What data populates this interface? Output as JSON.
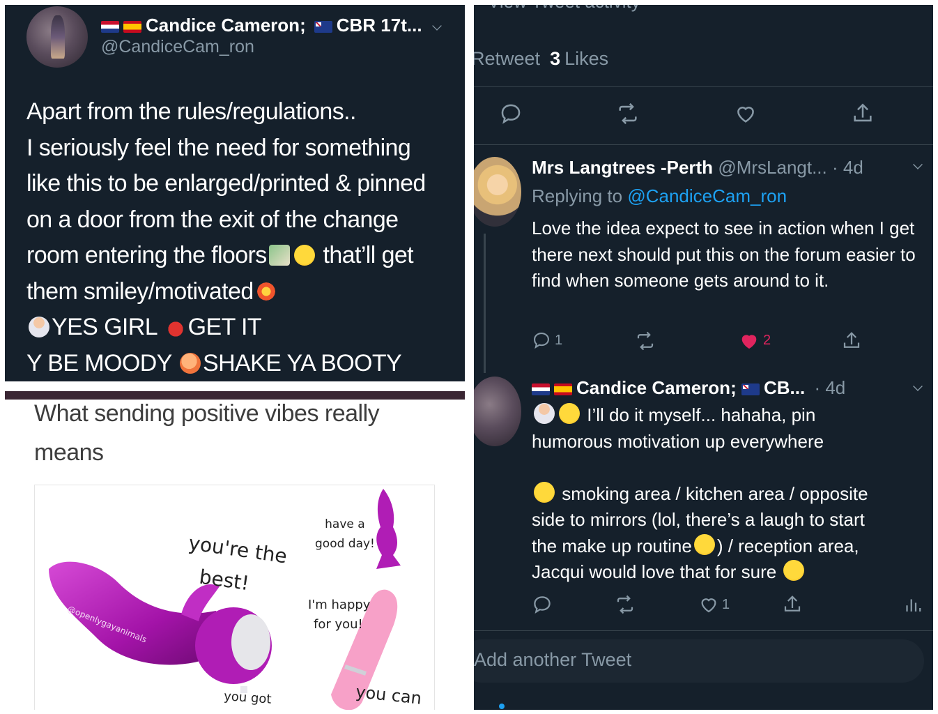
{
  "main_tweet": {
    "display_name": "Candice Cameron;",
    "display_name_suffix": "CBR 17t...",
    "handle": "@CandiceCam_ron",
    "flags": [
      "netherlands-antilles-flag-icon",
      "spain-flag-icon",
      "australia-flag-icon"
    ],
    "body_lines": [
      "Apart from the rules/regulations..",
      "I seriously feel the need for something",
      "like this to be enlarged/printed & pinned",
      "on a door from the exit of the change",
      "room entering the floors",
      "that’ll get",
      "them smiley/motivated",
      "YES GIRL",
      "GET IT",
      "Y BE MOODY",
      "SHAKE YA BOOTY"
    ]
  },
  "meme": {
    "caption": "What sending positive vibes really means",
    "watermark": "@openlygayanimals",
    "label_best_1": "you're the",
    "label_best_2": "best!",
    "label_goodday_1": "have a",
    "label_goodday_2": "good day!",
    "label_happy_1": "I'm happy",
    "label_happy_2": "for you!",
    "label_youcan": "you can",
    "label_yougot": "you got",
    "colors": {
      "toy_purple": "#b31fb3",
      "toy_pink": "#f7a1c8"
    }
  },
  "thread": {
    "activity_label": "View Tweet activity",
    "stats": {
      "retweet_label": "Retweet",
      "likes_count": "3",
      "likes_label": "Likes"
    },
    "actions": [
      "reply-icon",
      "retweet-icon",
      "like-icon",
      "share-icon"
    ],
    "reply1": {
      "display_name": "Mrs Langtrees -Perth",
      "handle_time": "@MrsLangt... · 4d",
      "replying_prefix": "Replying to",
      "replying_mention": "@CandiceCam_ron",
      "body": "Love the idea expect to see in action when I get there next should put this on the forum easier to find when someone gets around to it.",
      "reply_count": "1",
      "like_count": "2"
    },
    "reply2": {
      "display_name": "Candice Cameron;",
      "display_name_suffix": "CB...",
      "time": "· 4d",
      "lines": [
        "I’ll do it myself... hahaha, pin",
        "humorous motivation up everywhere",
        "",
        "smoking area / kitchen area / opposite",
        "side to mirrors (lol, there’s a laugh to start",
        "the make up routine",
        ") / reception area,",
        "Jacqui would love that for sure"
      ],
      "like_count": "1"
    },
    "compose_placeholder": "Add another Tweet",
    "colors": {
      "background": "#15202b",
      "secondary_text": "#8899a6",
      "accent": "#1da1f2",
      "like_red": "#e0245e"
    }
  }
}
